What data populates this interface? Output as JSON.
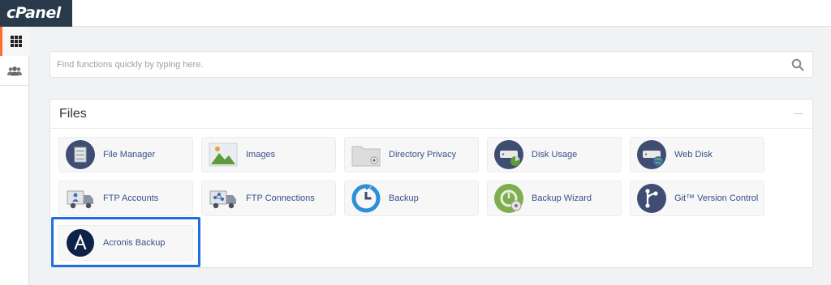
{
  "brand": {
    "logo_text": "cPanel",
    "logo_color": "#293a4a"
  },
  "sidebar": {
    "items": [
      {
        "name": "tools",
        "icon": "grid-icon",
        "active": true
      },
      {
        "name": "users",
        "icon": "users-icon",
        "active": false
      }
    ]
  },
  "search": {
    "placeholder": "Find functions quickly by typing here.",
    "value": ""
  },
  "files": {
    "title": "Files",
    "items": [
      {
        "label": "File Manager",
        "icon": "file-manager-icon"
      },
      {
        "label": "Images",
        "icon": "images-icon"
      },
      {
        "label": "Directory Privacy",
        "icon": "directory-privacy-icon"
      },
      {
        "label": "Disk Usage",
        "icon": "disk-usage-icon"
      },
      {
        "label": "Web Disk",
        "icon": "web-disk-icon"
      },
      {
        "label": "FTP Accounts",
        "icon": "ftp-accounts-icon"
      },
      {
        "label": "FTP Connections",
        "icon": "ftp-connections-icon"
      },
      {
        "label": "Backup",
        "icon": "backup-icon"
      },
      {
        "label": "Backup Wizard",
        "icon": "backup-wizard-icon"
      },
      {
        "label": "Git™ Version Control",
        "icon": "git-icon"
      },
      {
        "label": "Acronis Backup",
        "icon": "acronis-icon",
        "highlighted": true
      }
    ]
  },
  "colors": {
    "accent": "#ff6c2c",
    "highlight": "#1f6fe0",
    "link": "#37508b"
  }
}
